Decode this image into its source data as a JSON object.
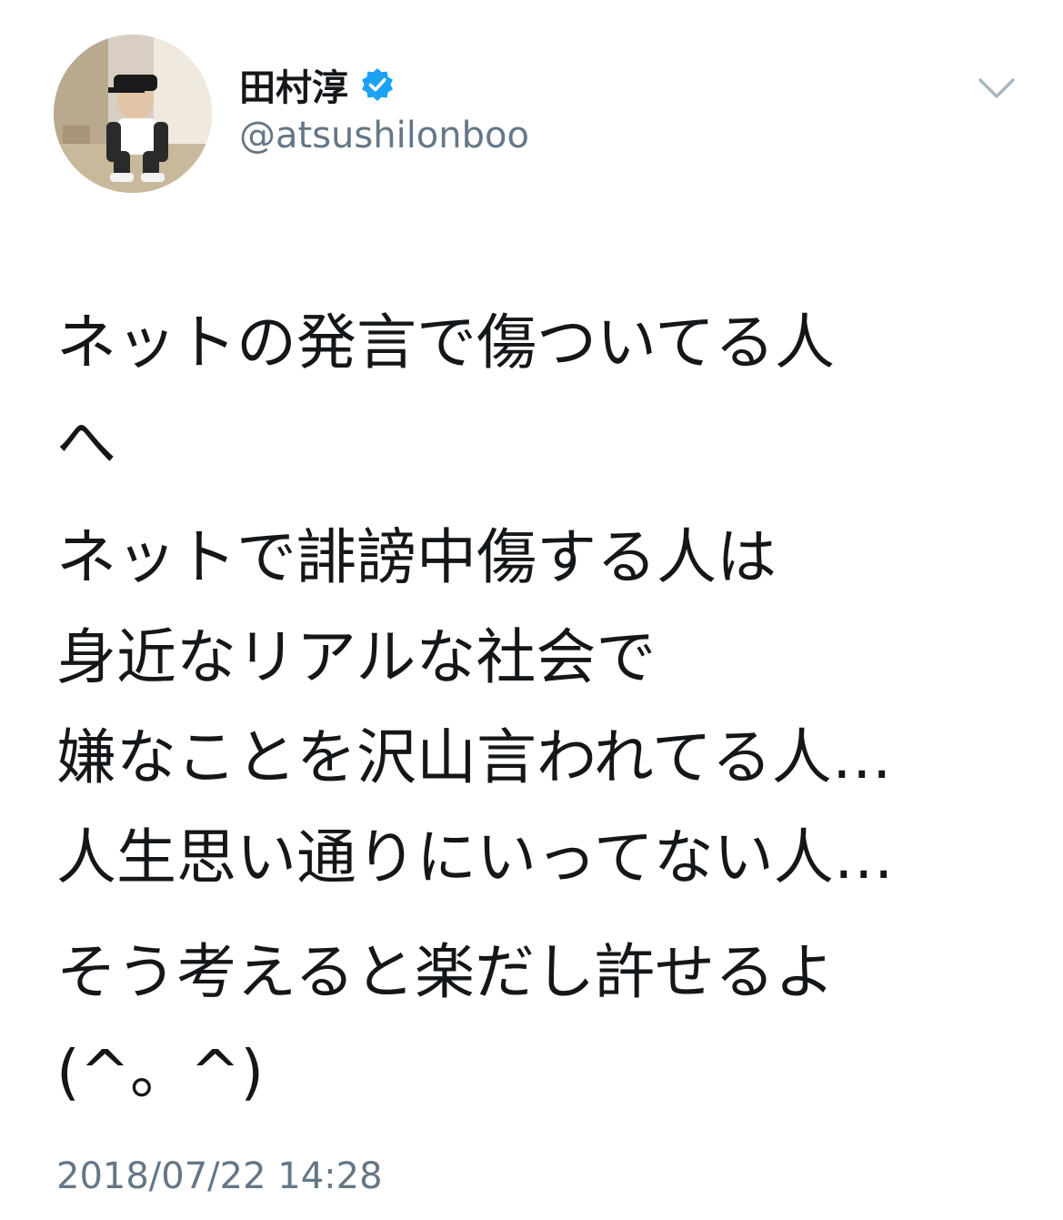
{
  "user": {
    "display_name": "田村淳",
    "handle": "@atsushilonboo",
    "avatar_icon": "user-avatar",
    "verified_icon": "verified-badge-icon",
    "verified_color": "#1da1f2"
  },
  "menu": {
    "icon": "chevron-down-icon",
    "color": "#aab8c2"
  },
  "tweet": {
    "paragraphs": [
      {
        "lines": [
          "ネットの発言で傷ついてる人",
          "へ"
        ]
      },
      {
        "lines": [
          "ネットで誹謗中傷する人は",
          "身近なリアルな社会で",
          "嫌なことを沢山言われてる人…",
          "人生思い通りにいってない人…"
        ]
      },
      {
        "lines": [
          "そう考えると楽だし許せるよ",
          "(^。^)"
        ]
      }
    ],
    "timestamp": "2018/07/22 14:28"
  }
}
